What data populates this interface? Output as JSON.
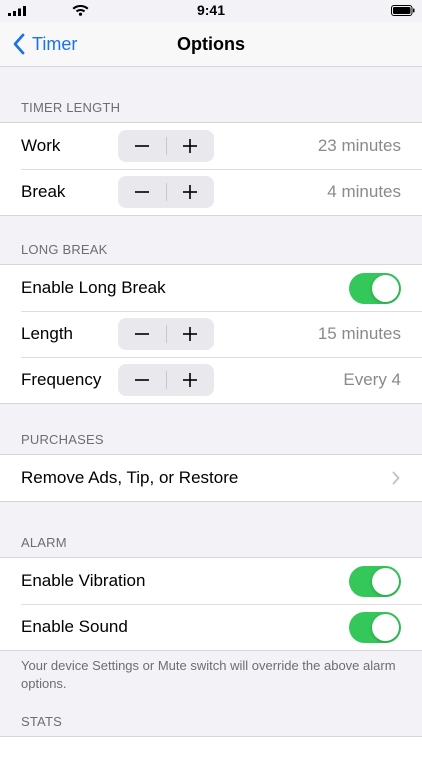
{
  "status_bar": {
    "time": "9:41"
  },
  "nav": {
    "back_label": "Timer",
    "title": "Options"
  },
  "colors": {
    "accent": "#1a73e8",
    "toggle_on": "#34c759"
  },
  "timer_length": {
    "header": "TIMER LENGTH",
    "rows": [
      {
        "label": "Work",
        "value": "23 minutes"
      },
      {
        "label": "Break",
        "value": "4 minutes"
      }
    ]
  },
  "long_break": {
    "header": "LONG BREAK",
    "enable_label": "Enable Long Break",
    "enable_on": true,
    "rows": [
      {
        "label": "Length",
        "value": "15 minutes"
      },
      {
        "label": "Frequency",
        "value": "Every 4"
      }
    ]
  },
  "purchases": {
    "header": "PURCHASES",
    "item_label": "Remove Ads, Tip, or Restore"
  },
  "alarm": {
    "header": "ALARM",
    "vibration_label": "Enable Vibration",
    "vibration_on": true,
    "sound_label": "Enable Sound",
    "sound_on": true,
    "footer": "Your device Settings or Mute switch will override the above alarm options."
  },
  "stats": {
    "header": "STATS"
  },
  "icons": [
    "signal-icon",
    "wifi-icon",
    "battery-icon",
    "back-chevron-icon",
    "minus-icon",
    "plus-icon",
    "chevron-right-icon"
  ]
}
